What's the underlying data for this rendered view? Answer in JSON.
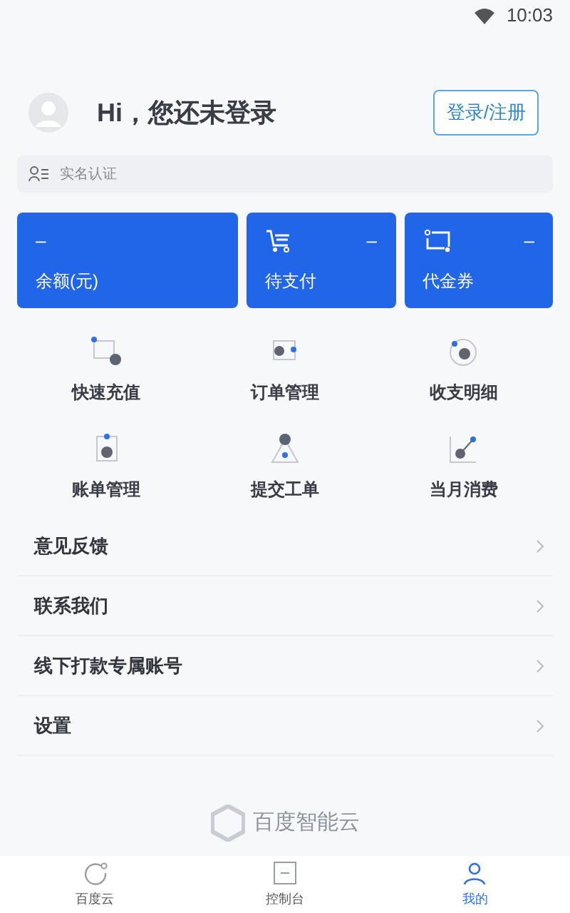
{
  "status_bar": {
    "time": "10:03"
  },
  "profile": {
    "greeting": "Hi，您还未登录",
    "login_button": "登录/注册",
    "verify_label": "实名认证"
  },
  "cards": [
    {
      "kind": "balance",
      "value": "–",
      "label": "余额(元)"
    },
    {
      "kind": "cart",
      "value": "–",
      "label": "待支付"
    },
    {
      "kind": "coupon",
      "value": "–",
      "label": "代金券"
    }
  ],
  "shortcuts": [
    {
      "kind": "recharge",
      "label": "快速充值"
    },
    {
      "kind": "orders",
      "label": "订单管理"
    },
    {
      "kind": "details",
      "label": "收支明细"
    },
    {
      "kind": "bills",
      "label": "账单管理"
    },
    {
      "kind": "ticket",
      "label": "提交工单"
    },
    {
      "kind": "monthly",
      "label": "当月消费"
    }
  ],
  "menu": [
    "意见反馈",
    "联系我们",
    "线下打款专属账号",
    "设置"
  ],
  "footer_logo": "百度智能云",
  "tabs": [
    {
      "kind": "home",
      "label": "百度云",
      "selected": false
    },
    {
      "kind": "console",
      "label": "控制台",
      "selected": false
    },
    {
      "kind": "me",
      "label": "我的",
      "selected": true
    }
  ]
}
